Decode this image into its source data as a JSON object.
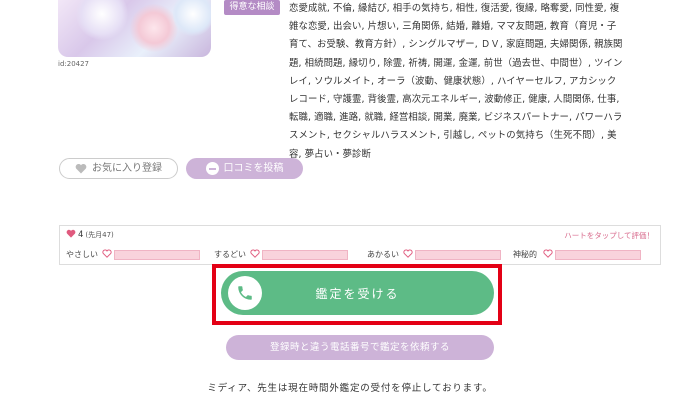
{
  "profile": {
    "id_label": "id:20427",
    "badge": "得意な相談",
    "description_lines": [
      "恋愛成就, 不倫, 縁結び, 相手の気持ち, 相性, 復活愛, 復縁, 略奪愛, 同性愛, 複",
      "雑な恋愛, 出会い, 片想い, 三角関係, 結婚, 離婚, ママ友問題, 教育（育児・子",
      "育て、お受験、教育方針）, シングルマザー, ＤＶ, 家庭問題, 夫婦関係, 親族関",
      "題, 相続問題, 縁切り, 除霊, 祈祷, 開運, 金運, 前世（過去世、中間世）, ツイン",
      "レイ, ソウルメイト, オーラ（波動、健康状態）, ハイヤーセルフ, アカシック",
      "レコード, 守護霊, 背後霊, 高次元エネルギー, 波動修正, 健康, 人間関係, 仕事,",
      "転職, 適職, 進路, 就職, 経営相談, 開業, 廃業, ビジネスパートナー, パワーハラ",
      "スメント, セクシャルハラスメント, 引越し, ペットの気持ち（生死不問）, 美",
      "容, 夢占い・夢診断"
    ]
  },
  "actions": {
    "favorite_label": "お気に入り登録",
    "review_label": "口コミを投稿"
  },
  "rating": {
    "count": "4",
    "period": "(先月47)",
    "tap_hint": "ハートをタップして評価！",
    "metrics": [
      {
        "label": "やさしい",
        "level": 0
      },
      {
        "label": "するどい",
        "level": 0
      },
      {
        "label": "あかるい",
        "level": 0
      },
      {
        "label": "神秘的",
        "level": 0
      }
    ]
  },
  "call": {
    "button_label": "鑑定を受ける",
    "request_label": "登録時と違う電話番号で鑑定を依頼する"
  },
  "notice": "ミディア、先生は現在時間外鑑定の受付を停止しております。",
  "colors": {
    "accent_purple": "#b48bc5",
    "call_green": "#5dbb86",
    "highlight_red": "#e30015",
    "heart_pink": "#e05a7e"
  }
}
